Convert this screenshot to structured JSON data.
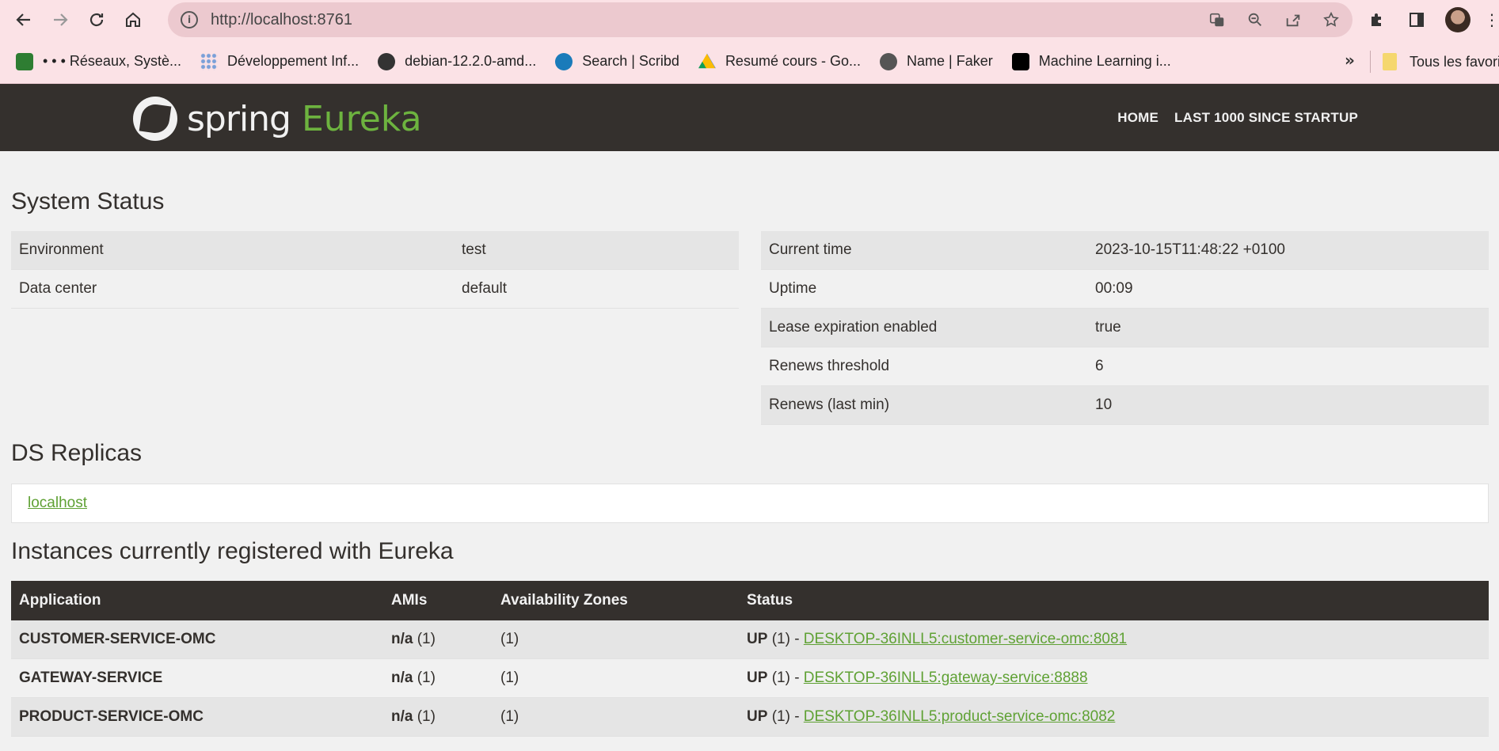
{
  "browser": {
    "url": "http://localhost:8761",
    "bookmarks": [
      {
        "label": "• • • Réseaux, Systè...",
        "icon": "image-icon",
        "color": "#2e7d32"
      },
      {
        "label": "Développement Inf...",
        "icon": "dots-icon",
        "color": "#7aa0d8"
      },
      {
        "label": "debian-12.2.0-amd...",
        "icon": "globe-icon",
        "color": "#333333"
      },
      {
        "label": "Search | Scribd",
        "icon": "scribd-icon",
        "color": "#1a7bba"
      },
      {
        "label": "Resumé cours - Go...",
        "icon": "drive-icon",
        "color": "#fbbc04"
      },
      {
        "label": "Name | Faker",
        "icon": "faker-icon",
        "color": "#555555"
      },
      {
        "label": "Machine Learning i...",
        "icon": "medium-icon",
        "color": "#000000"
      }
    ],
    "more_label": "»",
    "all_bookmarks_label": "Tous les favoris"
  },
  "eureka": {
    "brand_spring": "spring",
    "brand_eureka": "Eureka",
    "nav": {
      "home": "HOME",
      "last": "LAST 1000 SINCE STARTUP"
    },
    "accent": "#6db33f"
  },
  "system_status": {
    "title": "System Status",
    "left": [
      {
        "key": "Environment",
        "value": "test"
      },
      {
        "key": "Data center",
        "value": "default"
      }
    ],
    "right": [
      {
        "key": "Current time",
        "value": "2023-10-15T11:48:22 +0100"
      },
      {
        "key": "Uptime",
        "value": "00:09"
      },
      {
        "key": "Lease expiration enabled",
        "value": "true"
      },
      {
        "key": "Renews threshold",
        "value": "6"
      },
      {
        "key": "Renews (last min)",
        "value": "10"
      }
    ]
  },
  "replicas": {
    "title": "DS Replicas",
    "items": [
      "localhost"
    ]
  },
  "instances": {
    "title": "Instances currently registered with Eureka",
    "headers": [
      "Application",
      "AMIs",
      "Availability Zones",
      "Status"
    ],
    "rows": [
      {
        "app": "CUSTOMER-SERVICE-OMC",
        "ami": "n/a",
        "ami_count": "(1)",
        "zones": "(1)",
        "status": "UP",
        "status_count": "(1) -",
        "link": "DESKTOP-36INLL5:customer-service-omc:8081"
      },
      {
        "app": "GATEWAY-SERVICE",
        "ami": "n/a",
        "ami_count": "(1)",
        "zones": "(1)",
        "status": "UP",
        "status_count": "(1) -",
        "link": "DESKTOP-36INLL5:gateway-service:8888"
      },
      {
        "app": "PRODUCT-SERVICE-OMC",
        "ami": "n/a",
        "ami_count": "(1)",
        "zones": "(1)",
        "status": "UP",
        "status_count": "(1) -",
        "link": "DESKTOP-36INLL5:product-service-omc:8082"
      }
    ]
  }
}
